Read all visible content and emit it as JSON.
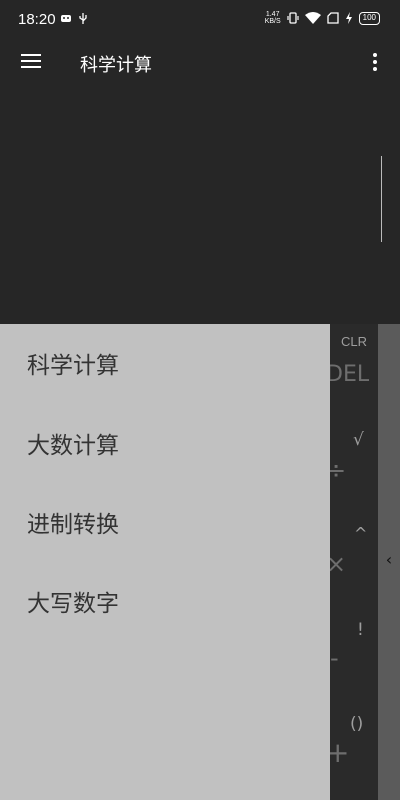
{
  "status_bar": {
    "time": "18:20",
    "net_speed_value": "1.47",
    "net_speed_unit": "KB/S",
    "battery": "100",
    "icons": [
      "android-icon",
      "usb-icon",
      "vibrate-icon",
      "wifi-icon",
      "sim-icon",
      "charging-icon",
      "battery-icon"
    ]
  },
  "app_bar": {
    "title": "科学计算",
    "menu_icon": "hamburger-menu-icon",
    "overflow_icon": "more-vert-icon"
  },
  "display": {
    "expression": "",
    "result": ""
  },
  "keypad": {
    "keys": {
      "clr": "CLR",
      "del": "DEL",
      "sqrt": "√",
      "div": "÷",
      "pow": "^",
      "mul": "×",
      "fact": "!",
      "minus": "-",
      "paren": "()",
      "plus": "+"
    },
    "side_toggle": "‹"
  },
  "drawer": {
    "items": [
      {
        "label": "科学计算"
      },
      {
        "label": "大数计算"
      },
      {
        "label": "进制转换"
      },
      {
        "label": "大写数字"
      }
    ]
  },
  "colors": {
    "background": "#262626",
    "drawer": "#c1c1c1",
    "side_panel": "#5b5b5b"
  }
}
